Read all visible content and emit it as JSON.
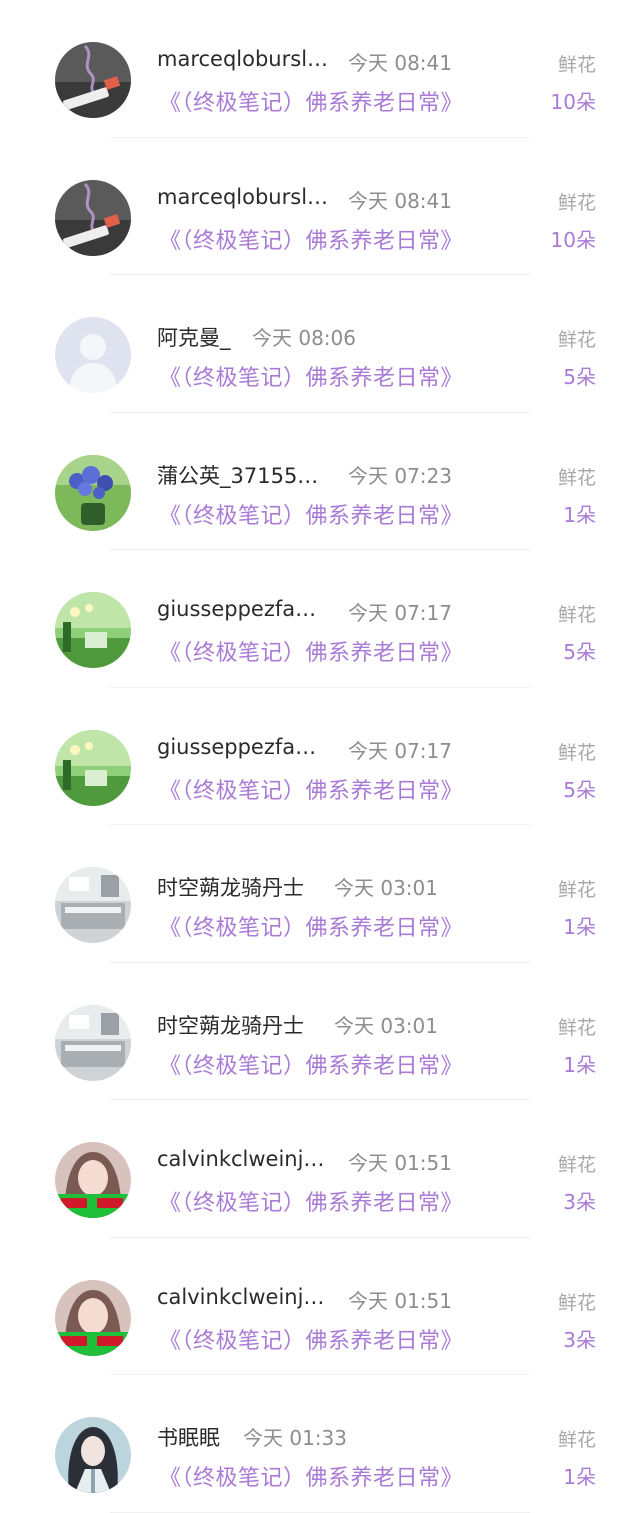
{
  "items": [
    {
      "name": "marceqlobursl…",
      "time": "今天 08:41",
      "book": "《（终极笔记）佛系养老日常》",
      "gift": "鲜花",
      "count": "10朵",
      "avatar": "cigarette-avatar-icon"
    },
    {
      "name": "marceqlobursl…",
      "time": "今天 08:41",
      "book": "《（终极笔记）佛系养老日常》",
      "gift": "鲜花",
      "count": "10朵",
      "avatar": "cigarette-avatar-icon"
    },
    {
      "name": "阿克曼_",
      "time": "今天 08:06",
      "book": "《（终极笔记）佛系养老日常》",
      "gift": "鲜花",
      "count": "5朵",
      "avatar": "default-user-avatar-icon"
    },
    {
      "name": "蒲公英_37155…",
      "time": "今天 07:23",
      "book": "《（终极笔记）佛系养老日常》",
      "gift": "鲜花",
      "count": "1朵",
      "avatar": "flower-avatar-icon"
    },
    {
      "name": "giusseppezfa…",
      "time": "今天 07:17",
      "book": "《（终极笔记）佛系养老日常》",
      "gift": "鲜花",
      "count": "5朵",
      "avatar": "green-scene-avatar-icon"
    },
    {
      "name": "giusseppezfa…",
      "time": "今天 07:17",
      "book": "《（终极笔记）佛系养老日常》",
      "gift": "鲜花",
      "count": "5朵",
      "avatar": "green-scene-avatar-icon"
    },
    {
      "name": "时空蒴龙骑丹士",
      "time": "今天 03:01",
      "book": "《（终极笔记）佛系养老日常》",
      "gift": "鲜花",
      "count": "1朵",
      "avatar": "room-avatar-icon"
    },
    {
      "name": "时空蒴龙骑丹士",
      "time": "今天 03:01",
      "book": "《（终极笔记）佛系养老日常》",
      "gift": "鲜花",
      "count": "1朵",
      "avatar": "room-avatar-icon"
    },
    {
      "name": "calvinkclweinj…",
      "time": "今天 01:51",
      "book": "《（终极笔记）佛系养老日常》",
      "gift": "鲜花",
      "count": "3朵",
      "avatar": "girl-avatar-icon"
    },
    {
      "name": "calvinkclweinj…",
      "time": "今天 01:51",
      "book": "《（终极笔记）佛系养老日常》",
      "gift": "鲜花",
      "count": "3朵",
      "avatar": "girl-avatar-icon"
    },
    {
      "name": "书眠眠",
      "time": "今天 01:33",
      "book": "《（终极笔记）佛系养老日常》",
      "gift": "鲜花",
      "count": "1朵",
      "avatar": "anime-character-avatar-icon"
    }
  ],
  "colors": {
    "accent": "#a97ad6",
    "name_text": "#2b2b2b",
    "muted_text": "#8d8d8d"
  }
}
